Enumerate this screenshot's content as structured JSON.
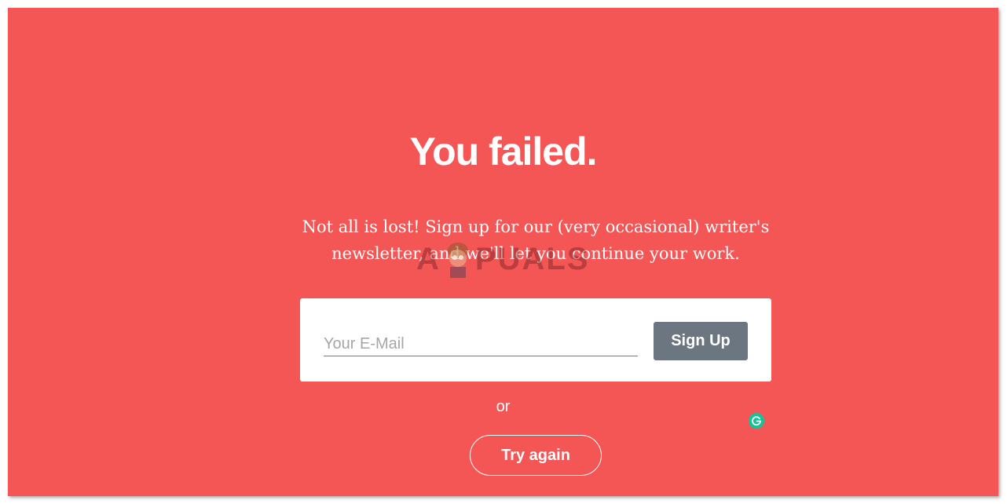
{
  "page": {
    "title": "You failed.",
    "subtitle_line1": "Not all is lost! Sign up for our (very occasional) writer's",
    "subtitle_line2": "newsletter, and we'll let you continue your work."
  },
  "signup_form": {
    "email_placeholder": "Your E-Mail",
    "email_value": "",
    "signup_label": "Sign Up"
  },
  "alternate": {
    "or_label": "or",
    "try_again_label": "Try again"
  },
  "watermark": {
    "text": "APPUALS"
  },
  "colors": {
    "background": "#f45656",
    "card": "#ffffff",
    "signup_button": "#6b7681",
    "grammarly": "#15c39a"
  },
  "icons": {
    "grammarly": "grammarly-icon"
  }
}
